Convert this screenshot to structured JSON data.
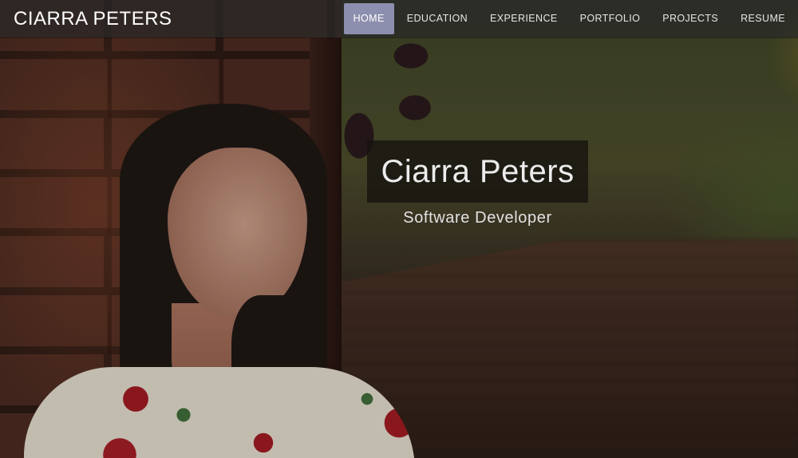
{
  "navbar": {
    "brand": "CIARRA PETERS",
    "links": [
      {
        "label": "HOME",
        "active": true
      },
      {
        "label": "EDUCATION",
        "active": false
      },
      {
        "label": "EXPERIENCE",
        "active": false
      },
      {
        "label": "PORTFOLIO",
        "active": false
      },
      {
        "label": "PROJECTS",
        "active": false
      },
      {
        "label": "RESUME",
        "active": false
      }
    ],
    "active_color": "#8d8fae"
  },
  "hero": {
    "title": "Ciarra Peters",
    "subtitle": "Software Developer"
  }
}
